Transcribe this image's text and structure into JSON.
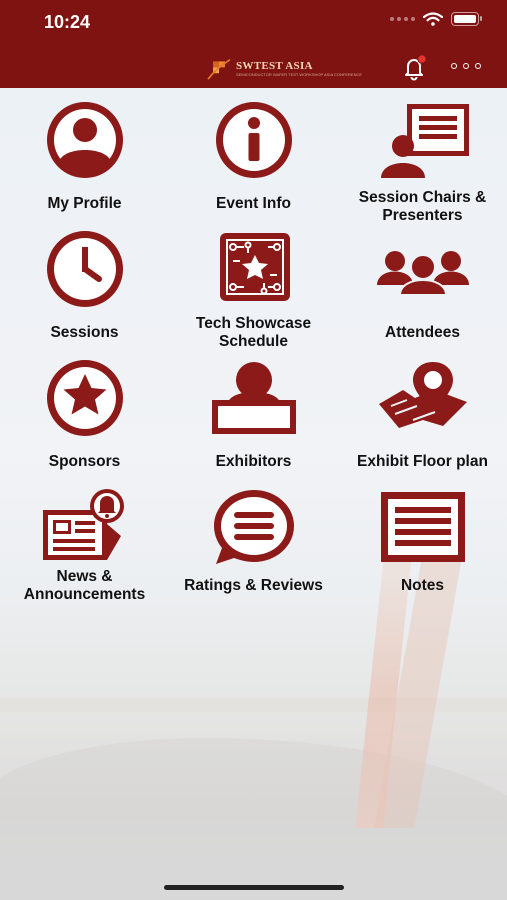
{
  "status_bar": {
    "time": "10:24"
  },
  "header": {
    "logo_title": "SWTEST ASIA",
    "logo_subtitle": "SEMICONDUCTOR WAFER TEST WORKSHOP ASIA CONFERENCE"
  },
  "colors": {
    "brand": "#7e1311",
    "icon": "#8b1a19",
    "text": "#111111"
  },
  "menu": [
    {
      "label": "My Profile",
      "icon": "profile-icon"
    },
    {
      "label": "Event Info",
      "icon": "info-icon"
    },
    {
      "label": "Session Chairs & Presenters",
      "icon": "presenter-icon"
    },
    {
      "label": "Sessions",
      "icon": "clock-icon"
    },
    {
      "label": "Tech Showcase Schedule",
      "icon": "circuit-icon"
    },
    {
      "label": "Attendees",
      "icon": "people-icon"
    },
    {
      "label": "Sponsors",
      "icon": "star-icon"
    },
    {
      "label": "Exhibitors",
      "icon": "exhibitor-icon"
    },
    {
      "label": "Exhibit Floor plan",
      "icon": "floor-plan-icon"
    },
    {
      "label": "News & Announcements",
      "icon": "news-icon"
    },
    {
      "label": "Ratings & Reviews",
      "icon": "chat-icon"
    },
    {
      "label": "Notes",
      "icon": "notes-icon"
    }
  ]
}
